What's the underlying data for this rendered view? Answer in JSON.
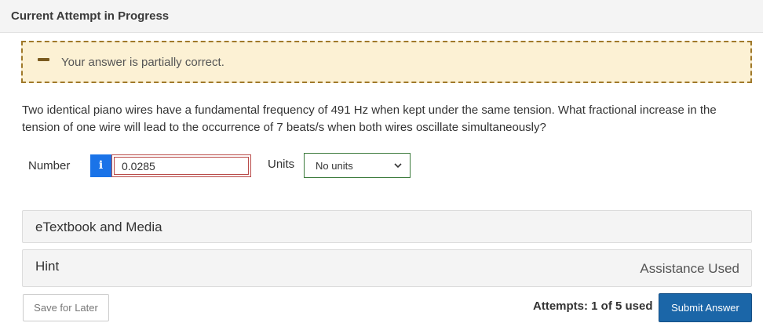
{
  "header": {
    "title": "Current Attempt in Progress"
  },
  "feedback": {
    "icon": "partial-correct-dash-icon",
    "text": "Your answer is partially correct.",
    "color": "#fcf1d4"
  },
  "question": {
    "text": "Two identical piano wires have a fundamental frequency of 491 Hz when kept under the same tension. What fractional increase in the tension of one wire will lead to the occurrence of 7 beats/s when both wires oscillate simultaneously?"
  },
  "answer": {
    "number_label": "Number",
    "info_icon": "i",
    "value": "0.0285",
    "units_label": "Units",
    "units_selected": "No units"
  },
  "panels": {
    "media_label": "eTextbook and Media",
    "hint_label": "Hint",
    "assistance_used": "Assistance Used"
  },
  "footer": {
    "save_label": "Save for Later",
    "attempts_text": "Attempts: 1 of 5 used",
    "submit_label": "Submit Answer"
  },
  "colors": {
    "accent": "#1b66a8",
    "info": "#1a73e8",
    "error_border": "#b94a48"
  }
}
